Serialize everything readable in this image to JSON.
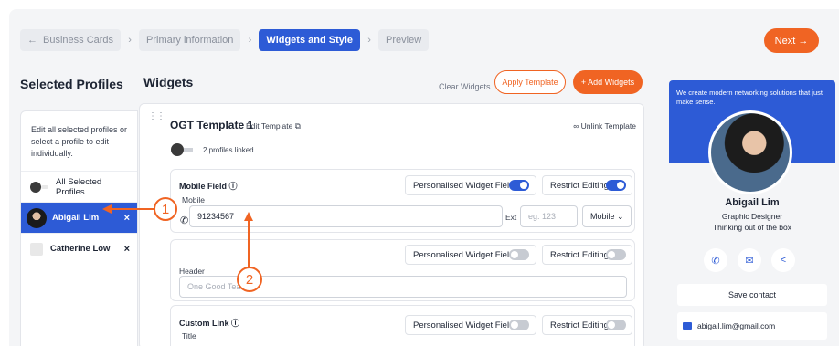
{
  "breadcrumbs": [
    {
      "label": "Business Cards"
    },
    {
      "label": "Primary information"
    },
    {
      "label": "Widgets and Style"
    },
    {
      "label": "Preview"
    }
  ],
  "next_label": "Next →",
  "left": {
    "title": "Selected Profiles",
    "help": "Edit all selected profiles or select a profile to edit individually.",
    "items": [
      {
        "label": "All Selected Profiles"
      },
      {
        "label": "Abigail Lim",
        "remove": "×"
      },
      {
        "label": "Catherine Low",
        "remove": "×"
      }
    ]
  },
  "widgets": {
    "title": "Widgets",
    "clear": "Clear Widgets",
    "apply": "Apply Template",
    "add": "+ Add Widgets",
    "template_name": "OGT Template 1",
    "edit_template": "Edit Template ⧉",
    "unlink": "∞ Unlink Template",
    "profiles_linked": "2 profiles linked",
    "personalised_label": "Personalised Widget Field",
    "restrict_label": "Restrict Editing",
    "mobile": {
      "label": "Mobile Field ⓘ",
      "sub": "Mobile",
      "value": "91234567",
      "ext_label": "Ext",
      "ext_placeholder": "eg. 123",
      "type": "Mobile ⌄",
      "personalised_on": true,
      "restrict_on": true
    },
    "header": {
      "label": "Header",
      "placeholder": "One Good Team",
      "personalised_on": false,
      "restrict_on": false
    },
    "custom_link": {
      "label": "Custom Link ⓘ",
      "sub": "Title",
      "personalised_on": false,
      "restrict_on": false
    }
  },
  "preview": {
    "tagline": "We create modern networking solutions that just make sense.",
    "name": "Abigail Lim",
    "role": "Graphic Designer",
    "motto": "Thinking out of the box",
    "icons": [
      "phone-icon",
      "email-icon",
      "share-icon"
    ],
    "save": "Save contact",
    "email": "abigail.lim@gmail.com"
  },
  "annotations": [
    "1",
    "2"
  ],
  "colors": {
    "accent": "#2d5bd6",
    "cta": "#f06423"
  }
}
